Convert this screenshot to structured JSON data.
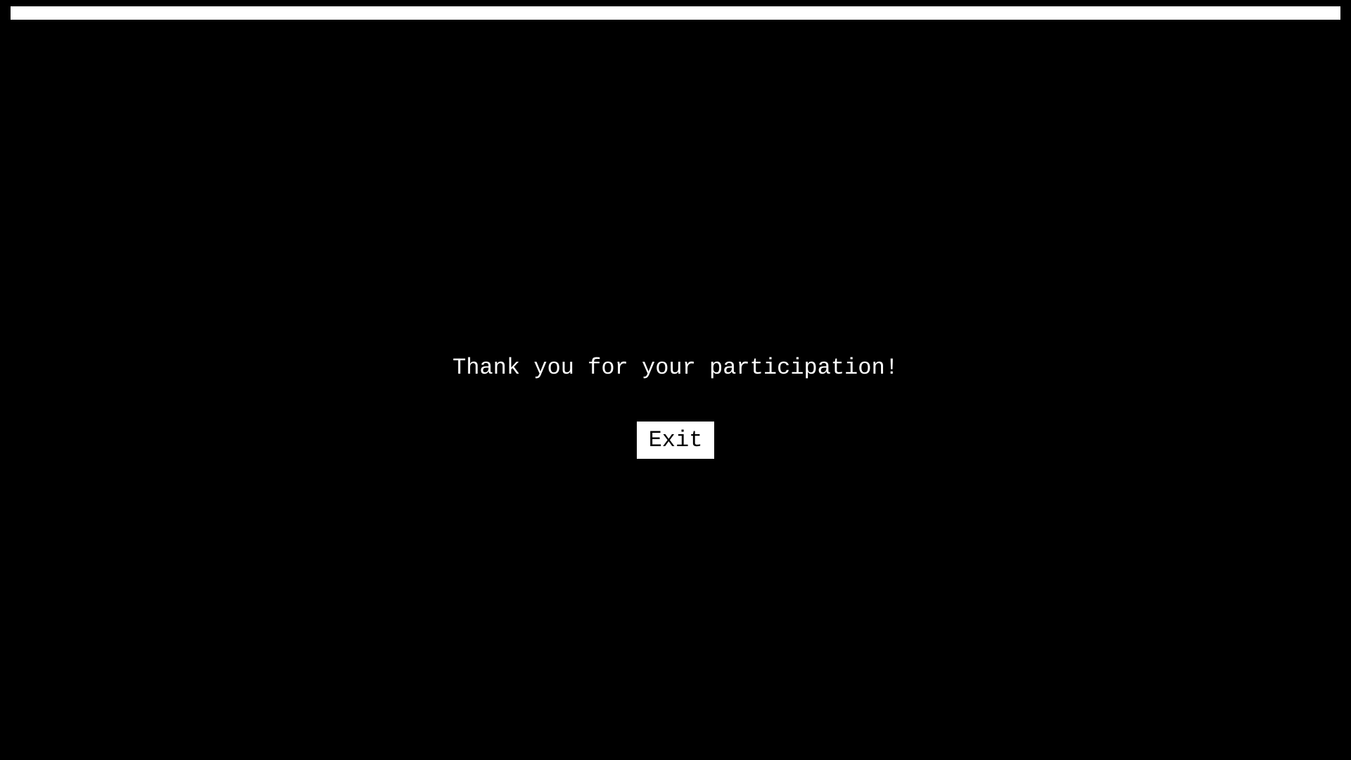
{
  "progress": {
    "fraction": 1.0,
    "fill_color": "#ffffff"
  },
  "main": {
    "message": "Thank you for your participation!",
    "exit_label": "Exit"
  },
  "colors": {
    "background": "#000000",
    "text": "#ffffff",
    "button_bg": "#ffffff",
    "button_text": "#000000"
  }
}
